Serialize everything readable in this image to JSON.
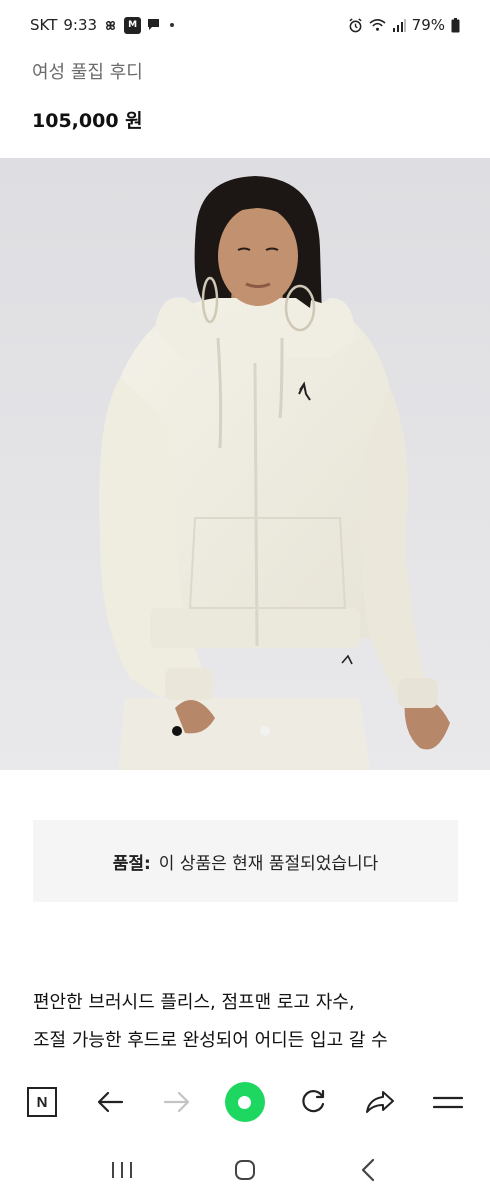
{
  "status_bar": {
    "carrier": "SKT",
    "time": "9:33",
    "m_badge": "M",
    "battery": "79%"
  },
  "product": {
    "subtitle": "여성 풀집 후디",
    "price": "105,000 원"
  },
  "sold_out": {
    "label": "품절:",
    "message": "이 상품은 현재 품절되었습니다"
  },
  "description": {
    "line1": "편안한 브러시드 플리스, 점프맨 로고 자수,",
    "line2": "조절 가능한 후드로 완성되어 어디든 입고 갈 수"
  },
  "toolbar": {
    "n_label": "N"
  },
  "colors": {
    "accent_green": "#1ed760",
    "image_bg": "#e4e4e6",
    "soldout_bg": "#f5f5f5"
  },
  "icons": [
    "pinwheel-icon",
    "m-badge-icon",
    "chat-icon",
    "alarm-icon",
    "wifi-icon",
    "signal-icon",
    "battery-icon",
    "back-arrow-icon",
    "forward-arrow-icon",
    "refresh-icon",
    "share-icon",
    "menu-icon",
    "recents-icon",
    "home-icon",
    "back-icon"
  ]
}
